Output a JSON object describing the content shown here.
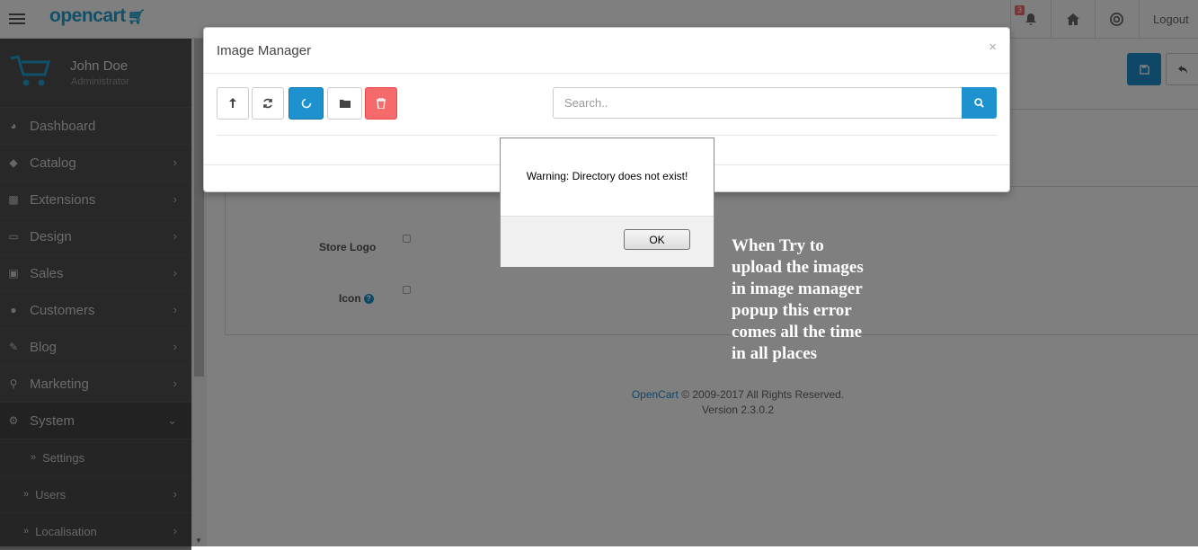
{
  "header": {
    "logo": "opencart",
    "notification_count": "3",
    "logout_label": "Logout"
  },
  "sidebar": {
    "user_name": "John Doe",
    "user_role": "Administrator",
    "items": [
      {
        "label": "Dashboard",
        "icon": "dashboard-icon"
      },
      {
        "label": "Catalog",
        "icon": "tag-icon"
      },
      {
        "label": "Extensions",
        "icon": "puzzle-icon"
      },
      {
        "label": "Design",
        "icon": "monitor-icon"
      },
      {
        "label": "Sales",
        "icon": "cart-icon"
      },
      {
        "label": "Customers",
        "icon": "user-icon"
      },
      {
        "label": "Blog",
        "icon": "edit-icon"
      },
      {
        "label": "Marketing",
        "icon": "share-icon"
      },
      {
        "label": "System",
        "icon": "cog-icon"
      }
    ],
    "subitems": [
      {
        "label": "Settings"
      },
      {
        "label": "Users"
      },
      {
        "label": "Localisation"
      }
    ]
  },
  "form": {
    "store_logo_label": "Store Logo",
    "icon_label": "Icon"
  },
  "footer": {
    "brand": "OpenCart",
    "copyright": "© 2009-2017 All Rights Reserved.",
    "version": "Version 2.3.0.2"
  },
  "modal": {
    "title": "Image Manager",
    "close": "×",
    "search_placeholder": "Search.."
  },
  "alert": {
    "message": "Warning: Directory does not exist!",
    "ok_label": "OK"
  },
  "annotation": {
    "lines": [
      "When Try to",
      "upload the images",
      "in image manager",
      "popup this error",
      "comes all the time",
      "in all places"
    ]
  },
  "colors": {
    "primary": "#1e91cf",
    "danger": "#f56b6b",
    "sidebar_bg": "#515151"
  }
}
